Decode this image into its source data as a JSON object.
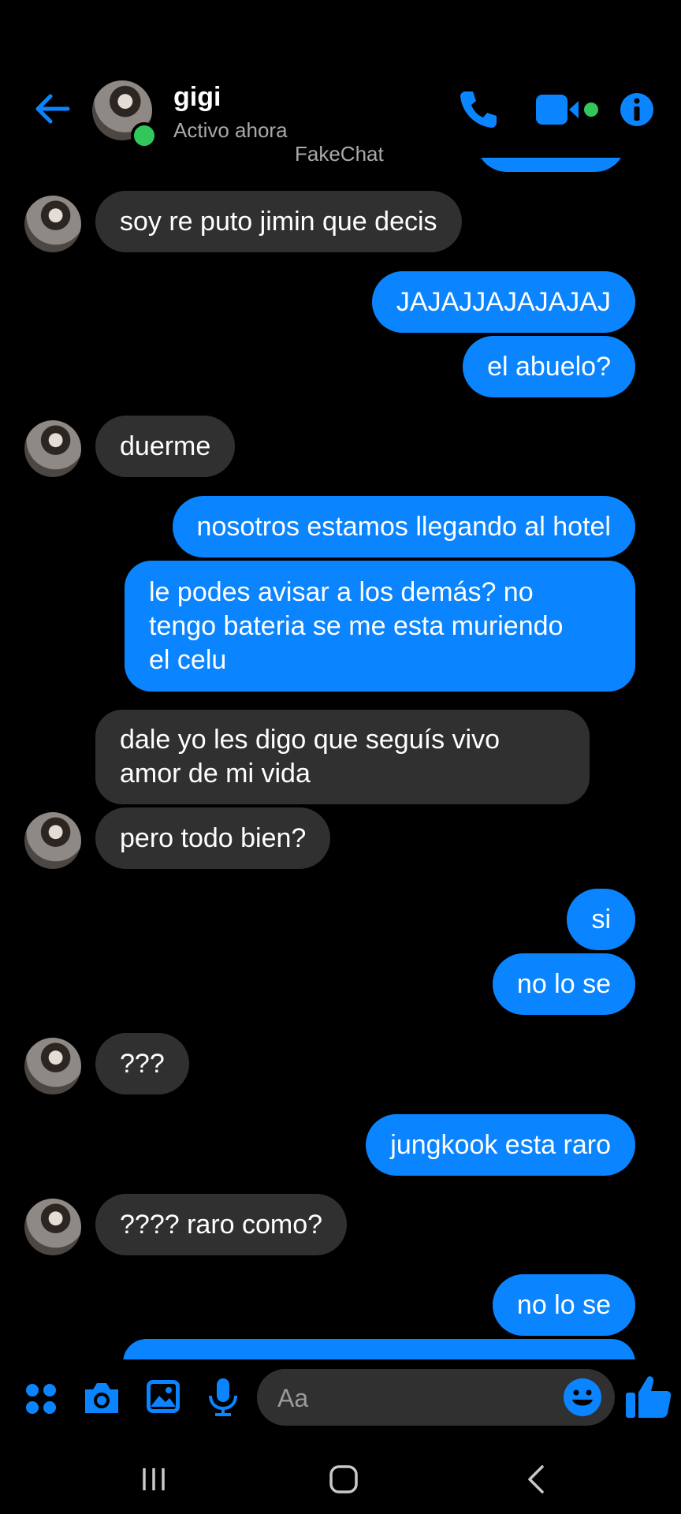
{
  "header": {
    "contact_name": "gigi",
    "status": "Activo ahora",
    "watermark": "FakeChat"
  },
  "messages": [
    {
      "side": "received",
      "text": "soy re puto jimin que decis",
      "avatar": true
    },
    {
      "side": "sent",
      "text": "JAJAJJAJAJAJAJ"
    },
    {
      "side": "sent",
      "text": "el abuelo?"
    },
    {
      "side": "received",
      "text": "duerme",
      "avatar": true
    },
    {
      "side": "sent",
      "text": "nosotros estamos llegando al hotel"
    },
    {
      "side": "sent",
      "text": "le podes avisar a los demás? no\ntengo bateria se me esta muriendo\nel celu"
    },
    {
      "side": "received",
      "text": "dale yo les digo que seguís vivo\namor de mi vida",
      "avatar": false
    },
    {
      "side": "received",
      "text": "pero todo bien?",
      "avatar": true
    },
    {
      "side": "sent",
      "text": "si"
    },
    {
      "side": "sent",
      "text": "no lo se"
    },
    {
      "side": "received",
      "text": "???",
      "avatar": true
    },
    {
      "side": "sent",
      "text": "jungkook esta raro"
    },
    {
      "side": "received",
      "text": "???? raro como?",
      "avatar": true
    },
    {
      "side": "sent",
      "text": "no lo se"
    }
  ],
  "composer": {
    "placeholder": "Aa"
  },
  "colors": {
    "accent": "#0a84ff",
    "received_bubble": "#303030",
    "online": "#31c75a",
    "background": "#000000"
  },
  "icons": [
    "back-arrow-icon",
    "phone-icon",
    "video-camera-icon",
    "info-icon",
    "apps-grid-icon",
    "camera-icon",
    "image-icon",
    "microphone-icon",
    "emoji-icon",
    "thumbs-up-icon",
    "recent-apps-icon",
    "home-icon",
    "nav-back-icon"
  ]
}
